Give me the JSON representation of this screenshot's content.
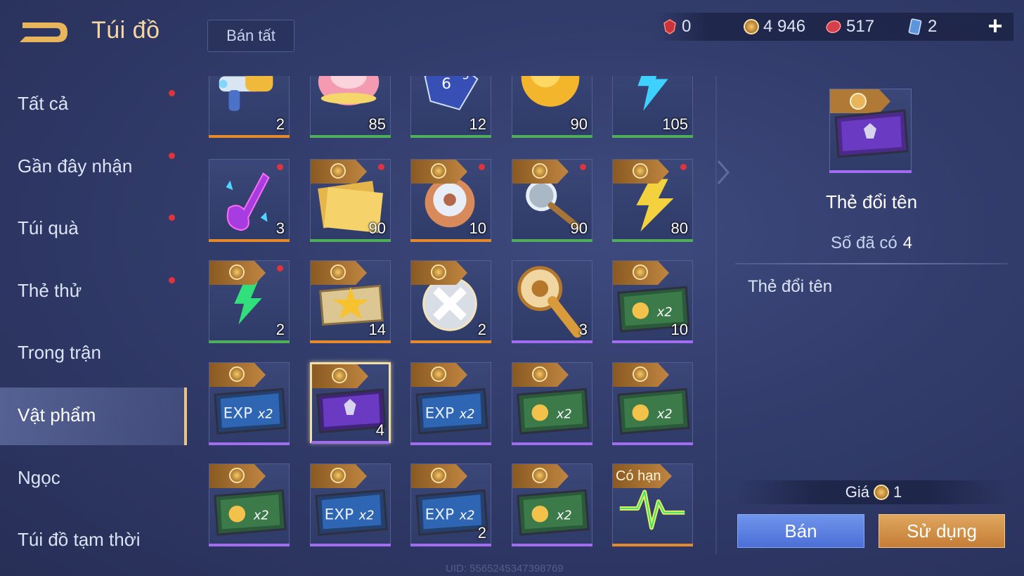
{
  "header": {
    "title": "Túi đồ",
    "sell_all_label": "Bán tất"
  },
  "currencies": [
    {
      "icon": "red-token-icon",
      "value": "0",
      "color": "#e0443c"
    },
    {
      "icon": "gold-coin-icon",
      "value": "4 946",
      "color": "#e6b650"
    },
    {
      "icon": "ruby-icon",
      "value": "517",
      "color": "#e04a4a"
    },
    {
      "icon": "blue-card-icon",
      "value": "2",
      "color": "#7fb2f0"
    }
  ],
  "sidebar": {
    "items": [
      {
        "label": "Tất cả",
        "has_dot": true,
        "active": false
      },
      {
        "label": "Gần đây nhận",
        "has_dot": true,
        "active": false
      },
      {
        "label": "Túi quà",
        "has_dot": true,
        "active": false
      },
      {
        "label": "Thẻ thử",
        "has_dot": true,
        "active": false
      },
      {
        "label": "Trong trận",
        "has_dot": false,
        "active": false
      },
      {
        "label": "Vật phẩm",
        "has_dot": false,
        "active": true
      },
      {
        "label": "Ngọc",
        "has_dot": false,
        "active": false
      },
      {
        "label": "Túi đồ tạm thời",
        "has_dot": false,
        "active": false
      }
    ]
  },
  "grid": {
    "rows": [
      [
        {
          "icon": "blaster-gun-icon",
          "qty": "2",
          "rarity": "orange",
          "tag": "",
          "dot": false
        },
        {
          "icon": "flower-cake-icon",
          "qty": "85",
          "rarity": "green",
          "tag": "",
          "dot": false
        },
        {
          "icon": "dice-icon",
          "qty": "12",
          "rarity": "green",
          "tag": "",
          "dot": false
        },
        {
          "icon": "gold-orb-icon",
          "qty": "90",
          "rarity": "green",
          "tag": "",
          "dot": false
        },
        {
          "icon": "blue-lightning-icon",
          "qty": "105",
          "rarity": "green",
          "tag": "",
          "dot": false
        }
      ],
      [
        {
          "icon": "neon-guitar-icon",
          "qty": "3",
          "rarity": "orange",
          "tag": "",
          "dot": true
        },
        {
          "icon": "gold-ticket-icon",
          "qty": "90",
          "rarity": "green",
          "tag": "coin",
          "dot": true
        },
        {
          "icon": "swirl-amulet-icon",
          "qty": "10",
          "rarity": "orange",
          "tag": "coin",
          "dot": true
        },
        {
          "icon": "magnifier-icon",
          "qty": "90",
          "rarity": "green",
          "tag": "coin",
          "dot": true
        },
        {
          "icon": "gold-lightning-icon",
          "qty": "80",
          "rarity": "green",
          "tag": "coin",
          "dot": true
        }
      ],
      [
        {
          "icon": "green-lightning-icon",
          "qty": "2",
          "rarity": "green",
          "tag": "coin",
          "dot": true
        },
        {
          "icon": "star-plaque-icon",
          "qty": "14",
          "rarity": "orange",
          "tag": "coin",
          "dot": false
        },
        {
          "icon": "silver-emblem-icon",
          "qty": "2",
          "rarity": "orange",
          "tag": "coin",
          "dot": false
        },
        {
          "icon": "golden-key-icon",
          "qty": "3",
          "rarity": "purple",
          "tag": "",
          "dot": false
        },
        {
          "icon": "gold-x2-card-icon",
          "qty": "10",
          "rarity": "purple",
          "tag": "coin",
          "dot": false
        }
      ],
      [
        {
          "icon": "exp-x2-card-icon",
          "qty": "",
          "rarity": "purple",
          "tag": "coin",
          "dot": false
        },
        {
          "icon": "rename-card-icon",
          "qty": "4",
          "rarity": "purple",
          "tag": "coin",
          "dot": false,
          "selected": true
        },
        {
          "icon": "exp-x2-card-icon",
          "qty": "",
          "rarity": "purple",
          "tag": "coin",
          "dot": false
        },
        {
          "icon": "gold-x2-card-icon",
          "qty": "",
          "rarity": "purple",
          "tag": "coin",
          "dot": false
        },
        {
          "icon": "gold-x2-card-icon",
          "qty": "",
          "rarity": "purple",
          "tag": "coin",
          "dot": false
        }
      ],
      [
        {
          "icon": "gold-x2-card-icon",
          "qty": "",
          "rarity": "purple",
          "tag": "coin",
          "dot": false
        },
        {
          "icon": "exp-x2-card-icon",
          "qty": "",
          "rarity": "purple",
          "tag": "coin",
          "dot": false
        },
        {
          "icon": "exp-x2-card-icon",
          "qty": "2",
          "rarity": "purple",
          "tag": "coin",
          "dot": false
        },
        {
          "icon": "gold-x2-card-icon",
          "qty": "",
          "rarity": "purple",
          "tag": "coin",
          "dot": false
        },
        {
          "icon": "heartbeat-icon",
          "qty": "",
          "rarity": "orange",
          "tag": "Có hạn",
          "dot": false
        }
      ]
    ]
  },
  "detail": {
    "icon": "rename-card-icon",
    "name": "Thẻ đổi tên",
    "owned_label": "Số đã có",
    "owned_value": "4",
    "description": "Thẻ đổi tên",
    "price_label": "Giá",
    "price_value": "1",
    "sell_label": "Bán",
    "use_label": "Sử dụng"
  },
  "footer": {
    "uid": "UID: 5565245347398769"
  },
  "colors": {
    "rarity_orange": "#e58a2c",
    "rarity_green": "#4fae5a",
    "rarity_purple": "#a26cf0",
    "accent_gold": "#e7c58a"
  }
}
